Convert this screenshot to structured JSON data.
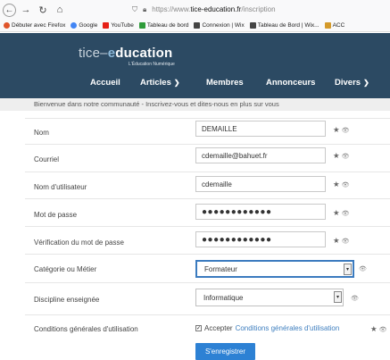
{
  "browser": {
    "back_icon": "arrow-left-icon",
    "url_prefix": "https://www.",
    "url_host": "tice-education.fr",
    "url_path": "/inscription",
    "bookmarks": [
      {
        "label": "Débuter avec Firefox",
        "color": "#e0552b"
      },
      {
        "label": "Google",
        "color": "#4285f4"
      },
      {
        "label": "YouTube",
        "color": "#e62117"
      },
      {
        "label": "Tableau de bord",
        "color": "#2e9b3a"
      },
      {
        "label": "Connexion | Wix",
        "color": "#444444"
      },
      {
        "label": "Tableau de Bord | Wix...",
        "color": "#444444"
      },
      {
        "label": "ACC",
        "color": "#d49a2a"
      }
    ]
  },
  "site": {
    "logo_part1": "tice",
    "logo_dash": "–",
    "logo_e": "e",
    "logo_part2": "ducation",
    "logo_sub": "L'Éducation Numérique",
    "header_color": "#2c4a63",
    "nav": [
      {
        "label": "Accueil",
        "dropdown": false
      },
      {
        "label": "Articles",
        "dropdown": true
      },
      {
        "label": "Membres",
        "dropdown": false
      },
      {
        "label": "Annonceurs",
        "dropdown": false
      },
      {
        "label": "Divers",
        "dropdown": true
      }
    ]
  },
  "welcome": "Bienvenue dans notre communauté - Inscrivez-vous et dites-nous en plus sur vous",
  "form": {
    "fields": [
      {
        "label": "Nom",
        "value": "DEMAILLE"
      },
      {
        "label": "Courriel",
        "value": "cdemaille@bahuet.fr"
      },
      {
        "label": "Nom d'utilisateur",
        "value": "cdemaille"
      },
      {
        "label": "Mot de passe",
        "value": "●●●●●●●●●●●●"
      },
      {
        "label": "Vérification du mot de passe",
        "value": "●●●●●●●●●●●●"
      }
    ],
    "category": {
      "label": "Catégorie ou Métier",
      "value": "Formateur"
    },
    "discipline": {
      "label": "Discipline enseignée",
      "value": "Informatique"
    },
    "terms": {
      "label": "Conditions générales d'utilisation",
      "accept": "Accepter",
      "link": "Conditions générales d'utilisation",
      "checked": true
    },
    "submit": "S'enregistrer",
    "accent_color": "#2d81d4"
  }
}
